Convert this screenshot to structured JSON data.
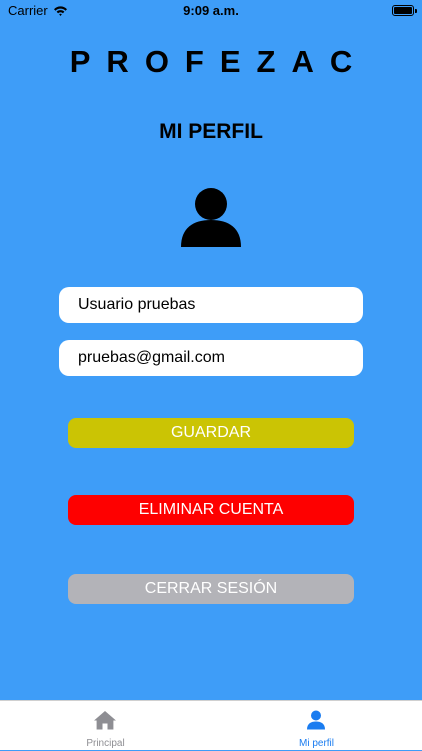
{
  "status_bar": {
    "carrier": "Carrier",
    "time": "9:09 a.m."
  },
  "header": {
    "app_title": "PROFEZAC",
    "page_title": "MI PERFIL"
  },
  "form": {
    "name_value": "Usuario pruebas",
    "email_value": "pruebas@gmail.com"
  },
  "buttons": {
    "save": "GUARDAR",
    "delete_account": "ELIMINAR CUENTA",
    "logout": "CERRAR SESIÓN"
  },
  "tab_bar": {
    "tabs": [
      {
        "label": "Principal",
        "icon": "home-icon",
        "active": false
      },
      {
        "label": "Mi perfil",
        "icon": "person-icon",
        "active": true
      }
    ]
  },
  "colors": {
    "background": "#3e9df8",
    "save_button": "#cbc404",
    "delete_button": "#fe0000",
    "logout_button": "#b3b3b8",
    "active_tab": "#1a7cf0",
    "inactive_tab": "#8e8e93"
  }
}
